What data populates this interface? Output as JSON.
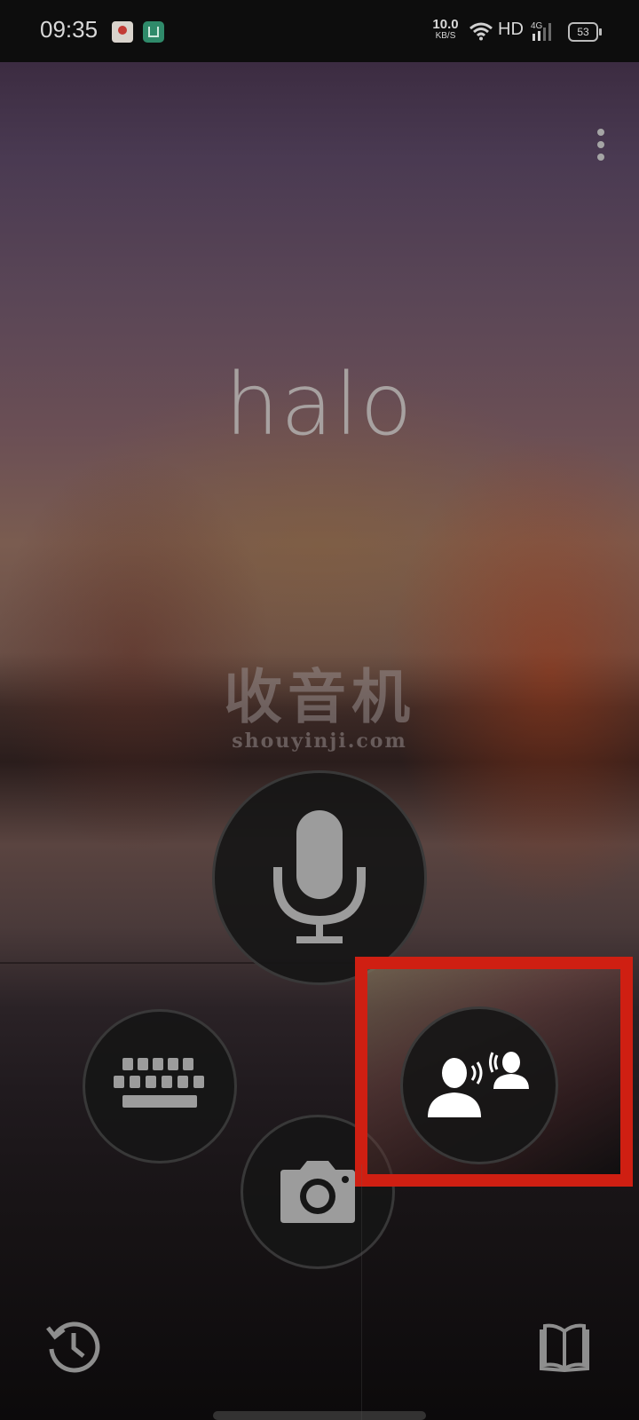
{
  "status_bar": {
    "time": "09:35",
    "net_speed_value": "10.0",
    "net_speed_unit": "KB/S",
    "hd_label": "HD",
    "network_type": "4G",
    "battery_level": "53"
  },
  "main": {
    "recognized_text": "halo"
  },
  "watermark": {
    "chinese": "收音机",
    "url": "shouyinji.com"
  },
  "colors": {
    "highlight": "#cf1f12",
    "icon_gray": "#9c9c9c",
    "icon_white": "#ffffff"
  },
  "icons": {
    "menu": "more-vert-icon",
    "mic": "microphone-icon",
    "keyboard": "keyboard-icon",
    "camera": "camera-icon",
    "conversation": "conversation-icon",
    "history": "history-icon",
    "phrasebook": "book-icon"
  }
}
